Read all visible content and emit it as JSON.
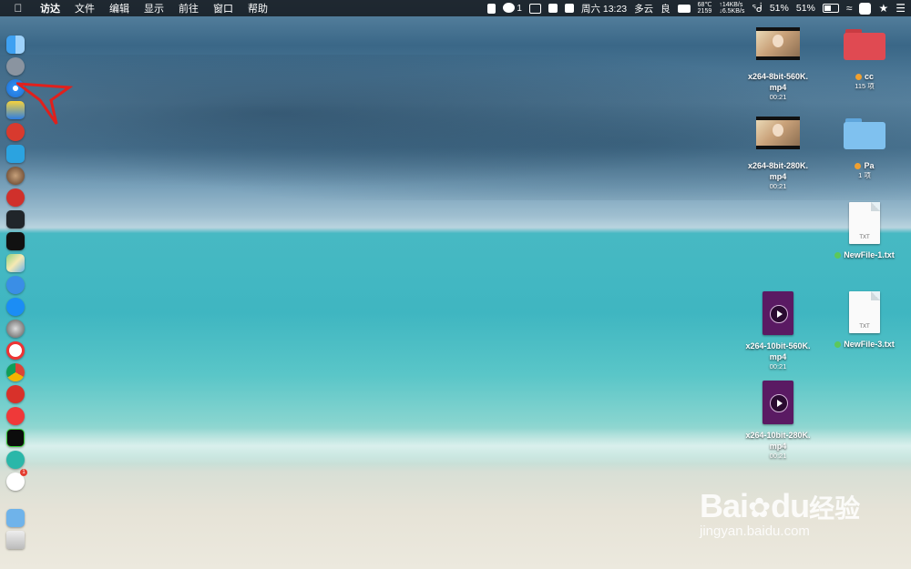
{
  "menubar": {
    "app_name": "访达",
    "items": [
      "文件",
      "编辑",
      "显示",
      "前往",
      "窗口",
      "帮助"
    ],
    "status": {
      "wechat_count": "1",
      "datetime": "周六 13:23",
      "weather": "多云",
      "air": "良",
      "temp": "68℃",
      "fan": "2159",
      "net_up": "↑14KB/s",
      "net_down": "↓6.5KB/s",
      "battery_pct_a": "51%",
      "battery_pct_b": "51%"
    }
  },
  "desktop": {
    "items": [
      {
        "name": "x264-8bit-560K.",
        "name2": "mp4",
        "sub": "00:21",
        "kind": "video-thumb"
      },
      {
        "name": "x264-8bit-280K.",
        "name2": "mp4",
        "sub": "00:21",
        "kind": "video-thumb"
      },
      {
        "name": "x264-10bit-560K.",
        "name2": "mp4",
        "sub": "00:21",
        "kind": "video-file"
      },
      {
        "name": "x264-10bit-280K.",
        "name2": "mp4",
        "sub": "00:21",
        "kind": "video-file"
      },
      {
        "name": "cc",
        "sub": "115 项",
        "kind": "folder",
        "tag_color": "#f0a030",
        "folder_color": "#e04a52"
      },
      {
        "name": "Pa",
        "sub": "1 项",
        "kind": "folder",
        "tag_color": "#f0a030",
        "folder_color": "#7fc1ef"
      },
      {
        "name": "NewFile-1.txt",
        "kind": "txt",
        "ext": "TXT",
        "tag_color": "#5cc85a"
      },
      {
        "name": "NewFile-3.txt",
        "kind": "txt",
        "ext": "TXT",
        "tag_color": "#5cc85a"
      }
    ]
  },
  "dock_icons": [
    "finder-icon",
    "launchpad-icon",
    "safari-icon",
    "preview-icon",
    "netease-red-icon",
    "migration-icon",
    "astro-icon",
    "netease-music-icon",
    "activity-monitor-icon",
    "terminal-icon",
    "maps-icon",
    "siri-icon",
    "app-store-icon",
    "system-preferences-icon",
    "yandex-icon",
    "chrome-icon",
    "netease-cloud-icon",
    "vivaldi-icon",
    "terminal-green-icon",
    "sync-icon",
    "wechat-icon",
    "downloads-icon",
    "trash-icon"
  ],
  "dock_badge": "1",
  "watermark": {
    "brand": "Bai",
    "brand2": "du",
    "cn": "经验",
    "url": "jingyan.baidu.com"
  }
}
